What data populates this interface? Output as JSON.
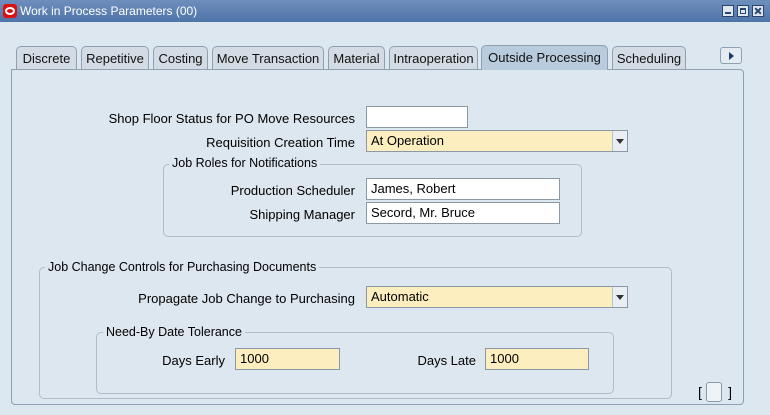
{
  "window": {
    "title": "Work in Process Parameters (00)"
  },
  "tabs": [
    {
      "label": "Discrete"
    },
    {
      "label": "Repetitive"
    },
    {
      "label": "Costing"
    },
    {
      "label": "Move Transaction"
    },
    {
      "label": "Material"
    },
    {
      "label": "Intraoperation"
    },
    {
      "label": "Outside Processing",
      "active": true
    },
    {
      "label": "Scheduling"
    }
  ],
  "form": {
    "shop_floor_status": {
      "label": "Shop Floor Status for PO Move Resources",
      "value": ""
    },
    "requisition_time": {
      "label": "Requisition Creation Time",
      "value": "At Operation"
    },
    "job_roles": {
      "title": "Job Roles for Notifications",
      "production_scheduler": {
        "label": "Production Scheduler",
        "value": "James, Robert"
      },
      "shipping_manager": {
        "label": "Shipping Manager",
        "value": "Secord, Mr. Bruce"
      }
    },
    "job_change": {
      "title": "Job Change Controls for Purchasing Documents",
      "propagate": {
        "label": "Propagate Job Change to Purchasing",
        "value": "Automatic"
      },
      "need_by": {
        "title": "Need-By Date Tolerance",
        "days_early": {
          "label": "Days Early",
          "value": "1000"
        },
        "days_late": {
          "label": "Days Late",
          "value": "1000"
        }
      }
    }
  },
  "bracket": {
    "left": "[",
    "right": "]"
  },
  "colors": {
    "titlebar": "#5a7db0",
    "required_field": "#fceebe",
    "background": "#dde7ef"
  }
}
